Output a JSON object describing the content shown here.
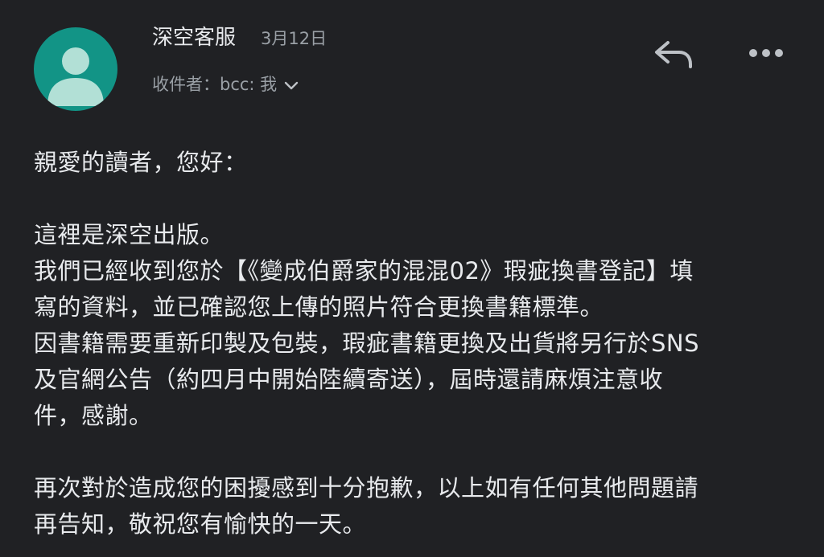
{
  "header": {
    "sender_name": "深空客服",
    "date": "3月12日",
    "recipient": "收件者：bcc: 我"
  },
  "icons": {
    "avatar": "person-avatar",
    "expand": "chevron-down-icon",
    "reply": "reply-icon",
    "more": "more-horizontal-icon"
  },
  "colors": {
    "background": "#202124",
    "avatar_bg": "#129486",
    "avatar_figure": "#b2e0d6"
  },
  "message": {
    "greeting": "親愛的讀者，您好：",
    "paragraph1": "這裡是深空出版。\n我們已經收到您於【《變成伯爵家的混混02》瑕疵換書登記】填\n寫的資料，並已確認您上傳的照片符合更換書籍標準。\n因書籍需要重新印製及包裝，瑕疵書籍更換及出貨將另行於SNS\n及官網公告（約四月中開始陸續寄送），屆時還請麻煩注意收\n件，感謝。",
    "paragraph2": "再次對於造成您的困擾感到十分抱歉，以上如有任何其他問題請\n再告知，敬祝您有愉快的一天。"
  }
}
